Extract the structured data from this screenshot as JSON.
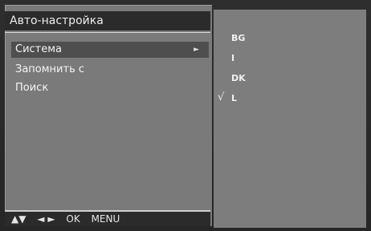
{
  "menu": {
    "title": "Авто-настройка",
    "items": [
      {
        "label": "Система",
        "arrow": "►"
      },
      {
        "label": "Запомнить с"
      },
      {
        "label": "Поиск"
      }
    ]
  },
  "submenu": {
    "options": [
      "BG",
      "I",
      "DK",
      "L"
    ],
    "checked_mark": "√"
  },
  "footer": {
    "nav_up_down": "▲▼",
    "nav_left_right": "◄ ►",
    "ok": "OK",
    "menu": "MENU"
  }
}
